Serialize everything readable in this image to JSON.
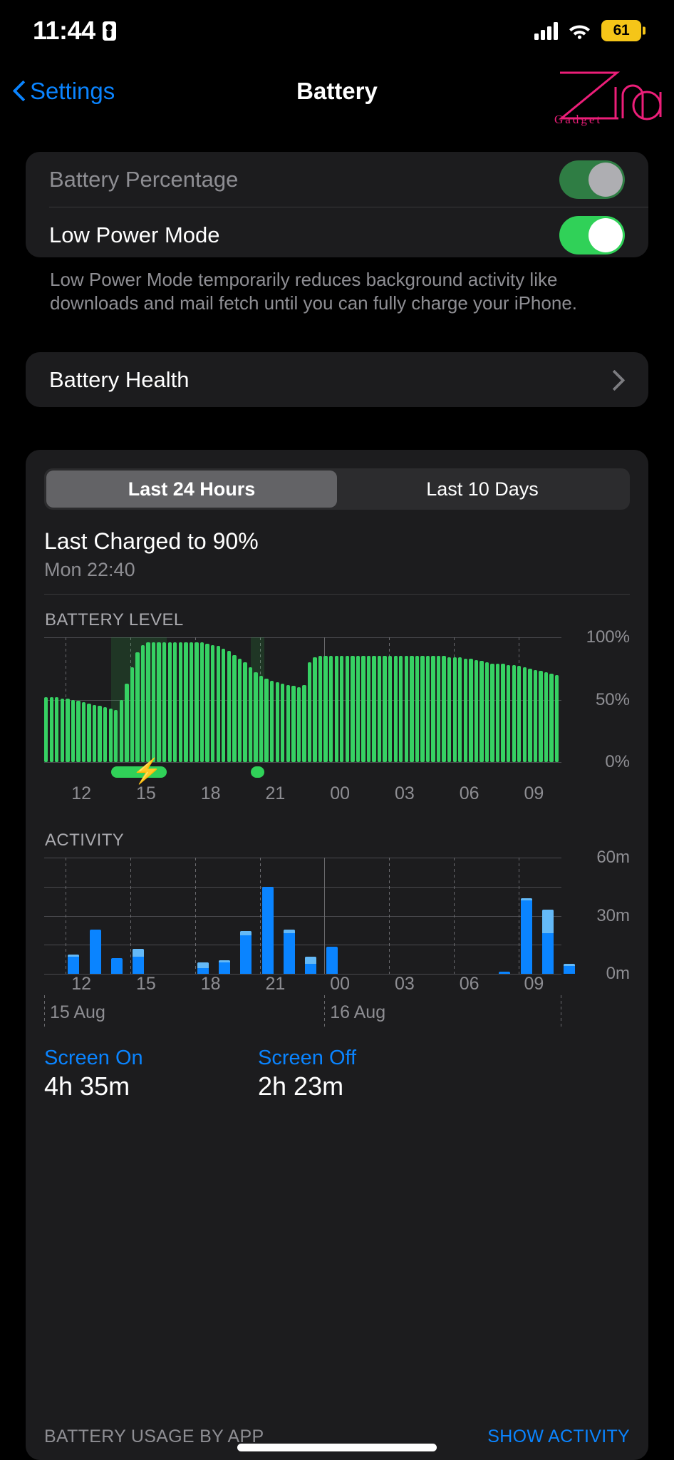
{
  "status_bar": {
    "time": "11:44",
    "battery_percent": "61",
    "lock_icon": "portrait-lock-icon",
    "signal_icon": "cellular-signal-icon",
    "wifi_icon": "wifi-icon"
  },
  "nav": {
    "back_label": "Settings",
    "title": "Battery",
    "logo_text": "Zing",
    "logo_sub": "Gadget",
    "logo_color": "#ec1e79"
  },
  "settings_card": {
    "rows": [
      {
        "label": "Battery Percentage",
        "toggle": "on",
        "enabled": false
      },
      {
        "label": "Low Power Mode",
        "toggle": "on",
        "enabled": true
      }
    ],
    "footnote": "Low Power Mode temporarily reduces background activity like downloads and mail fetch until you can fully charge your iPhone."
  },
  "health_card": {
    "label": "Battery Health",
    "chevron": "chevron-right-icon"
  },
  "battery_panel": {
    "segments": [
      {
        "label": "Last 24 Hours",
        "active": true
      },
      {
        "label": "Last 10 Days",
        "active": false
      }
    ],
    "last_charged_title": "Last Charged to 90%",
    "last_charged_sub": "Mon 22:40",
    "battery_level_label": "BATTERY LEVEL",
    "activity_label": "ACTIVITY",
    "day_labels": [
      "15 Aug",
      "16 Aug"
    ],
    "stats": [
      {
        "key": "Screen On",
        "value": "4h 35m"
      },
      {
        "key": "Screen Off",
        "value": "2h 23m"
      }
    ],
    "footer_left": "BATTERY USAGE BY APP",
    "footer_right": "SHOW ACTIVITY",
    "accent_blue": "#0a84ff",
    "accent_green": "#36d163"
  },
  "chart_data": [
    {
      "type": "bar",
      "name": "battery-level",
      "title": "BATTERY LEVEL",
      "xlabel": "",
      "ylabel": "",
      "ylim": [
        0,
        100
      ],
      "yticks": [
        0,
        50,
        100
      ],
      "ytick_labels": [
        "0%",
        "50%",
        "100%"
      ],
      "grid": true,
      "xtick_labels": [
        "12",
        "15",
        "18",
        "21",
        "00",
        "03",
        "06",
        "09"
      ],
      "xtick_positions_hours": [
        12,
        15,
        18,
        21,
        24,
        27,
        30,
        33
      ],
      "bar_color": "#36d163",
      "x_start_hour": 11,
      "x_end_hour": 35,
      "values": [
        52,
        52,
        52,
        51,
        51,
        50,
        49,
        48,
        47,
        46,
        45,
        44,
        43,
        42,
        50,
        63,
        76,
        88,
        94,
        96,
        96,
        96,
        96,
        96,
        96,
        96,
        96,
        96,
        96,
        96,
        95,
        94,
        93,
        91,
        89,
        86,
        83,
        80,
        76,
        72,
        69,
        67,
        65,
        64,
        63,
        62,
        61,
        60,
        62,
        80,
        84,
        85,
        85,
        85,
        85,
        85,
        85,
        85,
        85,
        85,
        85,
        85,
        85,
        85,
        85,
        85,
        85,
        85,
        85,
        85,
        85,
        85,
        85,
        85,
        85,
        84,
        84,
        84,
        83,
        83,
        82,
        81,
        80,
        79,
        79,
        79,
        78,
        78,
        77,
        76,
        75,
        74,
        73,
        72,
        71,
        70
      ],
      "charging_periods": [
        {
          "start_hour": 14.1,
          "end_hour": 16.7,
          "bolt": true
        },
        {
          "start_hour": 20.6,
          "end_hour": 21.2,
          "bolt": false
        }
      ]
    },
    {
      "type": "bar",
      "name": "activity",
      "title": "ACTIVITY",
      "xlabel": "",
      "ylabel": "",
      "ylim": [
        0,
        60
      ],
      "yticks": [
        0,
        30,
        60
      ],
      "ytick_labels": [
        "0m",
        "30m",
        "60m"
      ],
      "grid": true,
      "xtick_labels": [
        "12",
        "15",
        "18",
        "21",
        "00",
        "03",
        "06",
        "09"
      ],
      "xtick_positions_hours": [
        12,
        15,
        18,
        21,
        24,
        27,
        30,
        33
      ],
      "screen_on_color": "#0a84ff",
      "screen_off_color": "#64b9f7",
      "x_start_hour": 11,
      "x_end_hour": 35,
      "series": [
        {
          "name": "Screen On",
          "values": [
            0,
            9,
            23,
            8,
            9,
            0,
            0,
            3,
            6,
            20,
            45,
            21,
            5,
            14,
            0,
            0,
            0,
            0,
            0,
            0,
            0,
            1,
            38,
            21,
            4
          ]
        },
        {
          "name": "Screen Off",
          "values": [
            0,
            1,
            0,
            0,
            4,
            0,
            0,
            3,
            1,
            2,
            0,
            2,
            4,
            0,
            0,
            0,
            0,
            0,
            0,
            0,
            0,
            0,
            1,
            12,
            1
          ]
        }
      ],
      "bar_hours": [
        11,
        12,
        13,
        14,
        15,
        16,
        17,
        18,
        19,
        20,
        21,
        22,
        23,
        24,
        25,
        26,
        27,
        28,
        29,
        30,
        31,
        32,
        33,
        34,
        35
      ]
    }
  ]
}
